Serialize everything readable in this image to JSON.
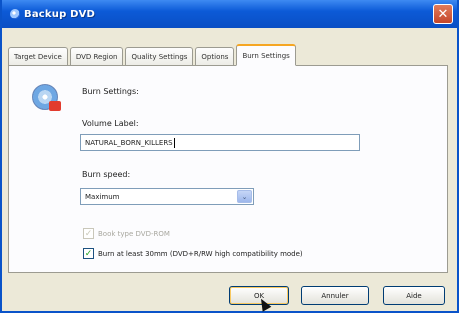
{
  "window": {
    "title": "Backup DVD",
    "close_glyph": "✕"
  },
  "tabs": [
    {
      "label": "Target Device"
    },
    {
      "label": "DVD Region"
    },
    {
      "label": "Quality Settings"
    },
    {
      "label": "Options"
    },
    {
      "label": "Burn Settings",
      "active": true
    }
  ],
  "panel": {
    "icon": "burn-disc-icon",
    "section_title": "Burn Settings:",
    "volume_label": {
      "label": "Volume Label:",
      "value": "NATURAL_BORN_KILLERS"
    },
    "burn_speed": {
      "label": "Burn speed:",
      "selected": "Maximum",
      "arrow": "⌄"
    },
    "book_type": {
      "label": "Book type DVD-ROM",
      "checked": true,
      "enabled": false,
      "glyph": "✓"
    },
    "burn_30mm": {
      "label": "Burn at least 30mm (DVD+R/RW high compatibility mode)",
      "checked": true,
      "enabled": true,
      "glyph": "✓"
    }
  },
  "buttons": {
    "ok": "OK",
    "cancel": "Annuler",
    "help": "Aide"
  }
}
